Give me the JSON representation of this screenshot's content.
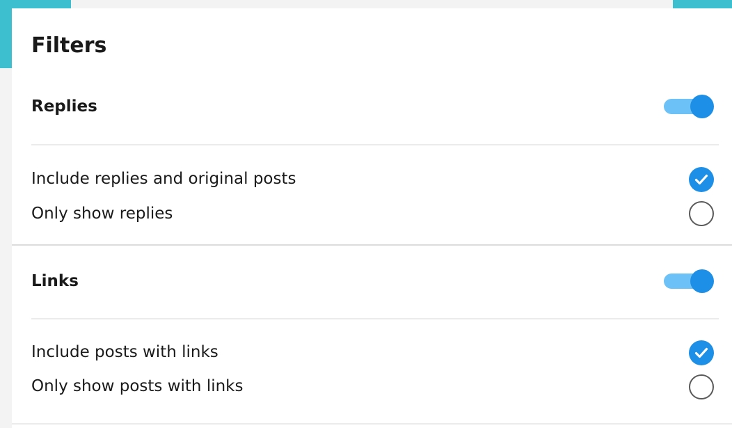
{
  "colors": {
    "accent": "#3dbfcf",
    "primary_blue": "#1d8fe6",
    "toggle_track": "#6cc1f6"
  },
  "filters": {
    "title": "Filters",
    "sections": [
      {
        "header": "Replies",
        "toggle_on": true,
        "options": [
          {
            "label": "Include replies and original posts",
            "selected": true,
            "icon": "check-circle-icon"
          },
          {
            "label": "Only show replies",
            "selected": false,
            "icon": "empty-circle-icon"
          }
        ]
      },
      {
        "header": "Links",
        "toggle_on": true,
        "options": [
          {
            "label": "Include posts with links",
            "selected": true,
            "icon": "check-circle-icon"
          },
          {
            "label": "Only show posts with links",
            "selected": false,
            "icon": "empty-circle-icon"
          }
        ]
      }
    ]
  }
}
